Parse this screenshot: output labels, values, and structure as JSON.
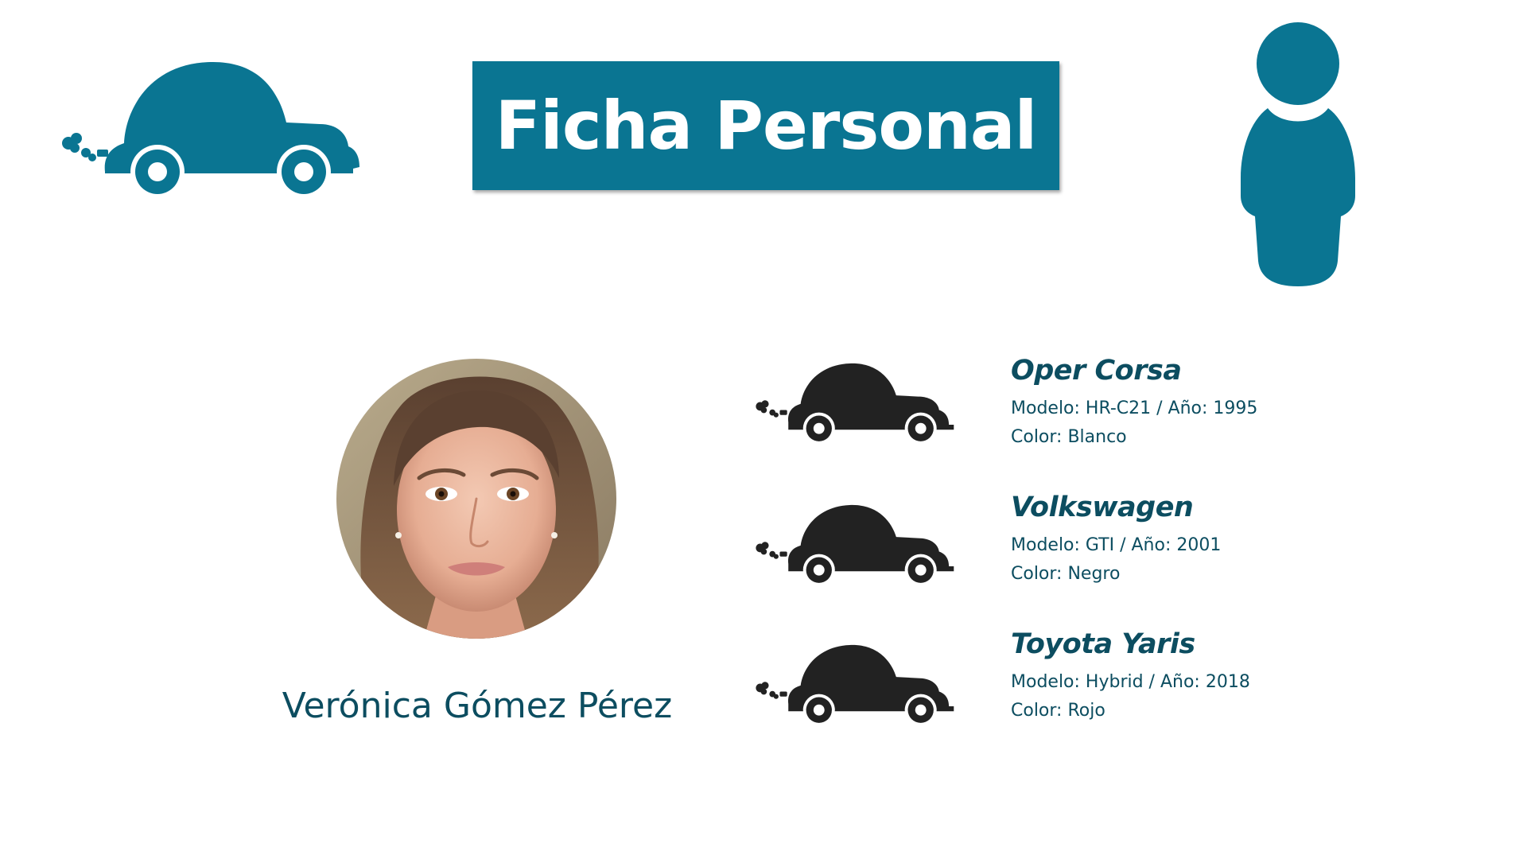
{
  "header": {
    "title": "Ficha Personal"
  },
  "colors": {
    "accent": "#0a7592",
    "text": "#0c4d60",
    "car_dark": "#222222"
  },
  "icons": {
    "top_left": "car-icon",
    "top_right": "person-icon",
    "list": "car-icon"
  },
  "person": {
    "name": "Verónica Gómez Pérez"
  },
  "cars": [
    {
      "name": "Oper Corsa",
      "model_line": "Modelo: HR-C21 / Año: 1995",
      "color_line": "Color: Blanco"
    },
    {
      "name": "Volkswagen",
      "model_line": "Modelo: GTI / Año: 2001",
      "color_line": "Color: Negro"
    },
    {
      "name": "Toyota Yaris",
      "model_line": "Modelo: Hybrid / Año: 2018",
      "color_line": "Color: Rojo"
    }
  ]
}
